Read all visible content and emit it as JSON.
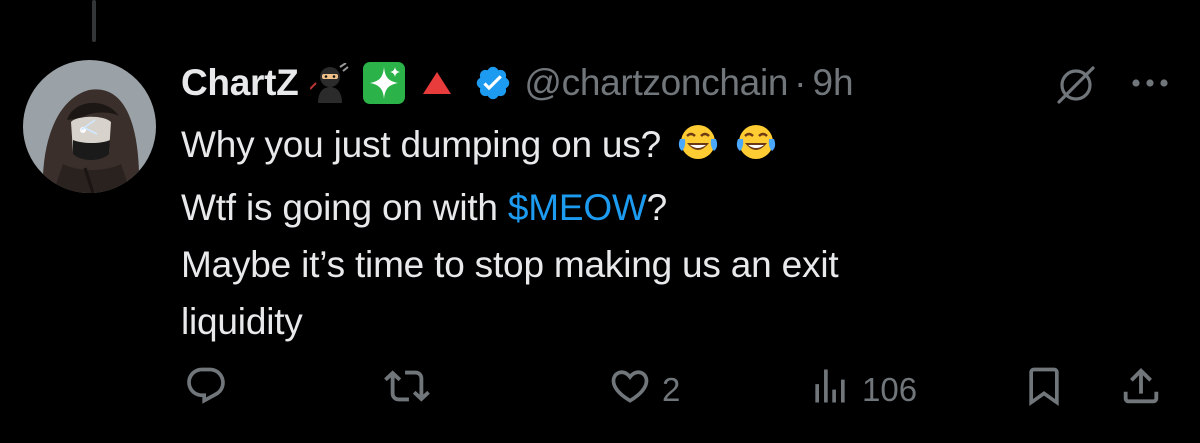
{
  "tweet": {
    "display_name": "ChartZ",
    "badges": [
      "ninja-emoji",
      "sparkle-emoji",
      "red-triangle-emoji",
      "verified-icon"
    ],
    "handle": "@chartzonchain",
    "separator": "·",
    "timestamp": "9h",
    "lines": {
      "line1": "Why you just dumping on us?",
      "line2_prefix": "Wtf is going on with ",
      "cashtag": "$MEOW",
      "line2_suffix": "?",
      "line3": "Maybe it’s time to stop making us an exit",
      "line4": "liquidity"
    },
    "line1_emojis": [
      "joy-emoji",
      "joy-emoji"
    ]
  },
  "actions": {
    "reply_icon": "reply-icon",
    "retweet_icon": "retweet-icon",
    "like_icon": "heart-icon",
    "like_count": "2",
    "views_icon": "views-icon",
    "view_count": "106",
    "bookmark_icon": "bookmark-icon",
    "share_icon": "share-icon"
  },
  "colors": {
    "background": "#000000",
    "text": "#e7e9ea",
    "muted": "#71767b",
    "accent": "#1d9bf0"
  }
}
